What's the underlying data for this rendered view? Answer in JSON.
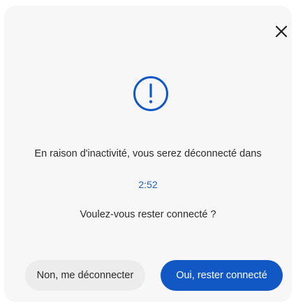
{
  "dialog": {
    "close_icon": "close-icon",
    "alert_icon": "exclamation-circle-icon",
    "message": "En raison d'inactivité, vous serez déconnecté dans",
    "countdown": "2:52",
    "question": "Voulez-vous rester connecté ?",
    "logout_button": "Non, me déconnecter",
    "stay_button": "Oui, rester connecté"
  },
  "colors": {
    "accent": "#1258c4",
    "timer_text": "#1f5fc4",
    "modal_bg": "#f7f7f7",
    "secondary_button_bg": "#ececec"
  }
}
